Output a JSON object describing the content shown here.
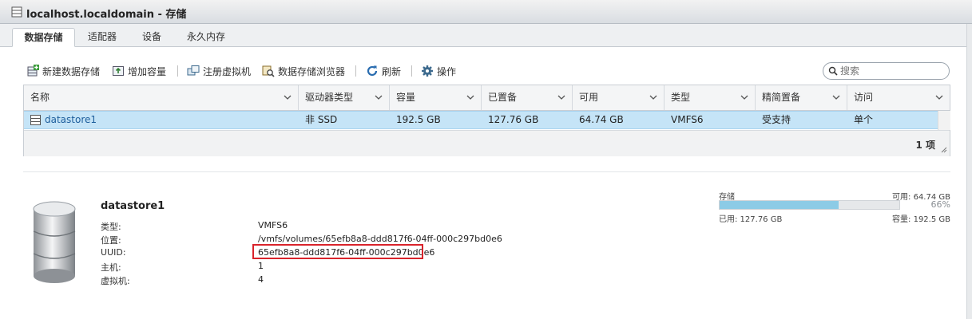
{
  "window": {
    "title": "localhost.localdomain - 存储"
  },
  "tabs": [
    {
      "label": "数据存储",
      "active": true
    },
    {
      "label": "适配器",
      "active": false
    },
    {
      "label": "设备",
      "active": false
    },
    {
      "label": "永久内存",
      "active": false
    }
  ],
  "toolbar": {
    "new_datastore": "新建数据存储",
    "increase_capacity": "增加容量",
    "register_vm": "注册虚拟机",
    "datastore_browser": "数据存储浏览器",
    "refresh": "刷新",
    "actions": "操作"
  },
  "search": {
    "placeholder": "搜索"
  },
  "table": {
    "columns": [
      "名称",
      "驱动器类型",
      "容量",
      "已置备",
      "可用",
      "类型",
      "精简置备",
      "访问"
    ],
    "rows": [
      {
        "name": "datastore1",
        "drive_type": "非 SSD",
        "capacity": "192.5 GB",
        "provisioned": "127.76 GB",
        "free": "64.74 GB",
        "type": "VMFS6",
        "thin": "受支持",
        "access": "单个"
      }
    ],
    "footer_count": "1 项"
  },
  "details": {
    "name": "datastore1",
    "props": [
      {
        "label": "类型:",
        "value": "VMFS6"
      },
      {
        "label": "位置:",
        "value": "/vmfs/volumes/65efb8a8-ddd817f6-04ff-000c297bd0e6"
      },
      {
        "label": "UUID:",
        "value": "65efb8a8-ddd817f6-04ff-000c297bd0e6"
      },
      {
        "label": "主机:",
        "value": "1"
      },
      {
        "label": "虚拟机:",
        "value": "4"
      }
    ]
  },
  "capacity": {
    "label": "存储",
    "free_text": "可用: 64.74 GB",
    "used_percent": 66,
    "percent_text": "66%",
    "used_text": "已用: 127.76 GB",
    "total_text": "容量: 192.5 GB"
  },
  "colors": {
    "selection": "#c5e4f7",
    "highlight_box": "#d9232b",
    "bar_fill": "#8ccbe6"
  }
}
